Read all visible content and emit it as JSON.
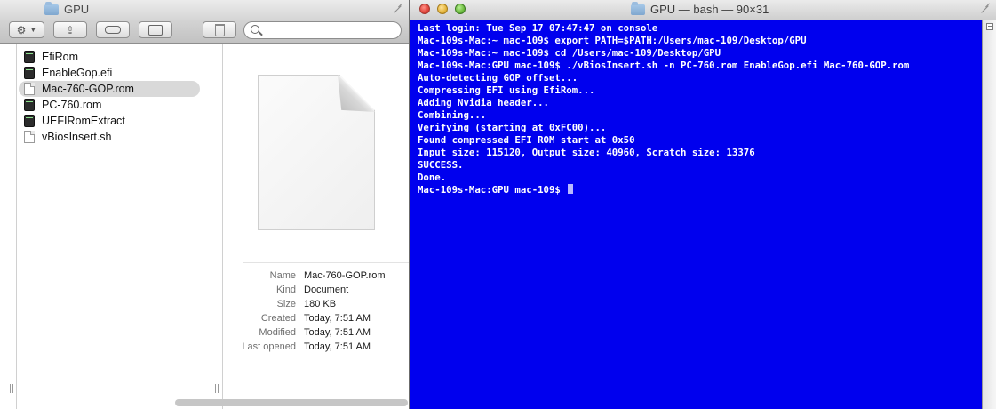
{
  "finder": {
    "title": "GPU",
    "search": {
      "value": "",
      "placeholder": ""
    },
    "files": [
      {
        "name": "EfiRom",
        "kind": "exec",
        "selected": false
      },
      {
        "name": "EnableGop.efi",
        "kind": "exec",
        "selected": false
      },
      {
        "name": "Mac-760-GOP.rom",
        "kind": "doc",
        "selected": true
      },
      {
        "name": "PC-760.rom",
        "kind": "exec",
        "selected": false
      },
      {
        "name": "UEFIRomExtract",
        "kind": "exec",
        "selected": false
      },
      {
        "name": "vBiosInsert.sh",
        "kind": "doc",
        "selected": false
      }
    ],
    "info": [
      {
        "key": "Name",
        "value": "Mac-760-GOP.rom"
      },
      {
        "key": "Kind",
        "value": "Document"
      },
      {
        "key": "Size",
        "value": "180 KB"
      },
      {
        "key": "Created",
        "value": "Today, 7:51 AM"
      },
      {
        "key": "Modified",
        "value": "Today, 7:51 AM"
      },
      {
        "key": "Last opened",
        "value": "Today, 7:51 AM"
      }
    ]
  },
  "terminal": {
    "title": "GPU — bash — 90×31",
    "lines": [
      "Last login: Tue Sep 17 07:47:47 on console",
      "Mac-109s-Mac:~ mac-109$ export PATH=$PATH:/Users/mac-109/Desktop/GPU",
      "Mac-109s-Mac:~ mac-109$ cd /Users/mac-109/Desktop/GPU",
      "Mac-109s-Mac:GPU mac-109$ ./vBiosInsert.sh -n PC-760.rom EnableGop.efi Mac-760-GOP.rom",
      "Auto-detecting GOP offset...",
      "Compressing EFI using EfiRom...",
      "Adding Nvidia header...",
      "Combining...",
      "Verifying (starting at 0xFC00)...",
      "Found compressed EFI ROM start at 0x50",
      "Input size: 115120, Output size: 40960, Scratch size: 13376",
      "SUCCESS.",
      "Done."
    ],
    "prompt": "Mac-109s-Mac:GPU mac-109$ "
  },
  "colors": {
    "terminal_bg": "#0000ee",
    "terminal_text": "#ffffff",
    "selection": "#d9d9d9"
  }
}
